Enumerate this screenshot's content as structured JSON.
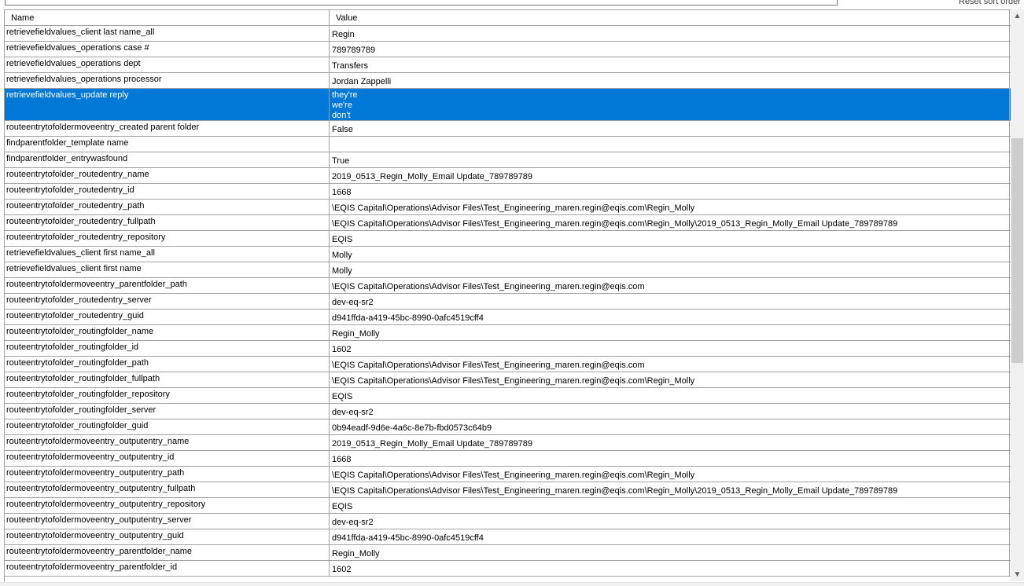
{
  "toolbar": {
    "reset_sort_label": "Reset sort order"
  },
  "grid": {
    "columns": [
      "Name",
      "Value"
    ],
    "selected_index": 4,
    "scroll_position_fraction": 0.36,
    "rows": [
      {
        "name": "retrievefieldvalues_client last name_all",
        "value": "Regin"
      },
      {
        "name": "retrievefieldvalues_operations case #",
        "value": "789789789"
      },
      {
        "name": "retrievefieldvalues_operations dept",
        "value": "Transfers"
      },
      {
        "name": "retrievefieldvalues_operations processor",
        "value": "Jordan Zappelli"
      },
      {
        "name": "retrievefieldvalues_update reply",
        "value": "they're\nwe're\ndon't"
      },
      {
        "name": "routeentrytofoldermoveentry_created parent folder",
        "value": "False"
      },
      {
        "name": "findparentfolder_template name",
        "value": ""
      },
      {
        "name": "findparentfolder_entrywasfound",
        "value": "True"
      },
      {
        "name": "routeentrytofolder_routedentry_name",
        "value": "2019_0513_Regin_Molly_Email Update_789789789"
      },
      {
        "name": "routeentrytofolder_routedentry_id",
        "value": "1668"
      },
      {
        "name": "routeentrytofolder_routedentry_path",
        "value": "\\EQIS Capital\\Operations\\Advisor Files\\Test_Engineering_maren.regin@eqis.com\\Regin_Molly"
      },
      {
        "name": "routeentrytofolder_routedentry_fullpath",
        "value": "\\EQIS Capital\\Operations\\Advisor Files\\Test_Engineering_maren.regin@eqis.com\\Regin_Molly\\2019_0513_Regin_Molly_Email Update_789789789"
      },
      {
        "name": "routeentrytofolder_routedentry_repository",
        "value": "EQIS"
      },
      {
        "name": "retrievefieldvalues_client first name_all",
        "value": "Molly"
      },
      {
        "name": "retrievefieldvalues_client first name",
        "value": "Molly"
      },
      {
        "name": "routeentrytofoldermoveentry_parentfolder_path",
        "value": "\\EQIS Capital\\Operations\\Advisor Files\\Test_Engineering_maren.regin@eqis.com"
      },
      {
        "name": "routeentrytofolder_routedentry_server",
        "value": "dev-eq-sr2"
      },
      {
        "name": "routeentrytofolder_routedentry_guid",
        "value": "d941ffda-a419-45bc-8990-0afc4519cff4"
      },
      {
        "name": "routeentrytofolder_routingfolder_name",
        "value": "Regin_Molly"
      },
      {
        "name": "routeentrytofolder_routingfolder_id",
        "value": "1602"
      },
      {
        "name": "routeentrytofolder_routingfolder_path",
        "value": "\\EQIS Capital\\Operations\\Advisor Files\\Test_Engineering_maren.regin@eqis.com"
      },
      {
        "name": "routeentrytofolder_routingfolder_fullpath",
        "value": "\\EQIS Capital\\Operations\\Advisor Files\\Test_Engineering_maren.regin@eqis.com\\Regin_Molly"
      },
      {
        "name": "routeentrytofolder_routingfolder_repository",
        "value": "EQIS"
      },
      {
        "name": "routeentrytofolder_routingfolder_server",
        "value": "dev-eq-sr2"
      },
      {
        "name": "routeentrytofolder_routingfolder_guid",
        "value": "0b94eadf-9d6e-4a6c-8e7b-fbd0573c64b9"
      },
      {
        "name": "routeentrytofoldermoveentry_outputentry_name",
        "value": "2019_0513_Regin_Molly_Email Update_789789789"
      },
      {
        "name": "routeentrytofoldermoveentry_outputentry_id",
        "value": "1668"
      },
      {
        "name": "routeentrytofoldermoveentry_outputentry_path",
        "value": "\\EQIS Capital\\Operations\\Advisor Files\\Test_Engineering_maren.regin@eqis.com\\Regin_Molly"
      },
      {
        "name": "routeentrytofoldermoveentry_outputentry_fullpath",
        "value": "\\EQIS Capital\\Operations\\Advisor Files\\Test_Engineering_maren.regin@eqis.com\\Regin_Molly\\2019_0513_Regin_Molly_Email Update_789789789"
      },
      {
        "name": "routeentrytofoldermoveentry_outputentry_repository",
        "value": "EQIS"
      },
      {
        "name": "routeentrytofoldermoveentry_outputentry_server",
        "value": "dev-eq-sr2"
      },
      {
        "name": "routeentrytofoldermoveentry_outputentry_guid",
        "value": "d941ffda-a419-45bc-8990-0afc4519cff4"
      },
      {
        "name": "routeentrytofoldermoveentry_parentfolder_name",
        "value": "Regin_Molly"
      },
      {
        "name": "routeentrytofoldermoveentry_parentfolder_id",
        "value": "1602"
      }
    ]
  },
  "scrollbar": {
    "up_icon": "chevron-up-icon",
    "down_icon": "chevron-down-icon"
  }
}
